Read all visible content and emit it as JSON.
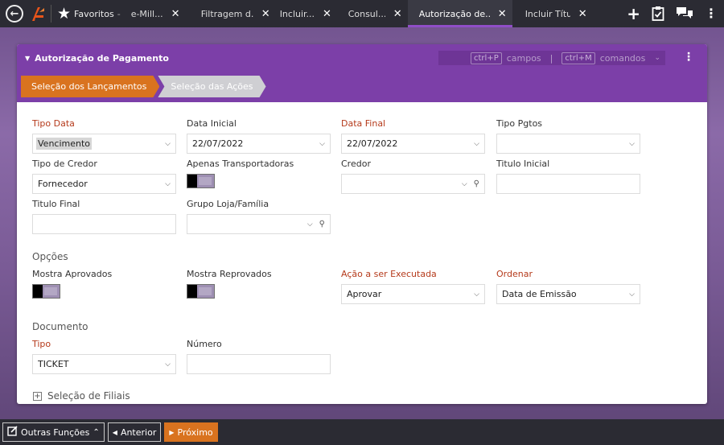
{
  "topbar": {
    "favoritos": "Favoritos",
    "favoritos_caret": "-",
    "tabs": [
      {
        "label": "e-Mill..."
      },
      {
        "label": "Filtragem d..."
      },
      {
        "label": "Incluir..."
      },
      {
        "label": "Consul..."
      },
      {
        "label": "Autorização de..."
      },
      {
        "label": "Incluir Títu..."
      }
    ],
    "active_tab_index": 4,
    "colors": {
      "bar": "#2b2b33",
      "active_underline": "#8f4ec7",
      "logo": "#e8541a"
    }
  },
  "card": {
    "title": "Autorização de Pagamento",
    "shortcuts": {
      "key1": "ctrl+P",
      "label1": "campos",
      "separator": "|",
      "key2": "ctrl+M",
      "label2": "comandos"
    },
    "steps": [
      {
        "label": "Seleção dos Lançamentos",
        "active": true
      },
      {
        "label": "Seleção das Ações",
        "active": false
      }
    ],
    "header_color": "#7c3fa8",
    "accent_color": "#d9731f"
  },
  "form": {
    "tipo_data": {
      "label": "Tipo Data",
      "value": "Vencimento"
    },
    "data_inicial": {
      "label": "Data Inicial",
      "value": "22/07/2022"
    },
    "data_final": {
      "label": "Data Final",
      "value": "22/07/2022"
    },
    "tipo_pgtos": {
      "label": "Tipo Pgtos",
      "value": ""
    },
    "tipo_credor": {
      "label": "Tipo de Credor",
      "value": "Fornecedor"
    },
    "apenas_transportadoras": {
      "label": "Apenas Transportadoras"
    },
    "credor": {
      "label": "Credor",
      "value": ""
    },
    "titulo_inicial": {
      "label": "Titulo Inicial",
      "value": ""
    },
    "titulo_final": {
      "label": "Titulo Final",
      "value": ""
    },
    "grupo_loja": {
      "label": "Grupo Loja/Família",
      "value": ""
    },
    "opcoes_section": "Opções",
    "mostra_aprovados": {
      "label": "Mostra Aprovados"
    },
    "mostra_reprovados": {
      "label": "Mostra Reprovados"
    },
    "acao": {
      "label": "Ação a ser Executada",
      "value": "Aprovar"
    },
    "ordenar": {
      "label": "Ordenar",
      "value": "Data de Emissão"
    },
    "documento_section": "Documento",
    "tipo": {
      "label": "Tipo",
      "value": "TICKET"
    },
    "numero": {
      "label": "Número",
      "value": ""
    },
    "filiais": "Seleção de Filiais",
    "required_label_color": "#b53a1b"
  },
  "bottombar": {
    "outras_funcoes": "Outras Funções",
    "anterior": "Anterior",
    "proximo": "Próximo"
  }
}
